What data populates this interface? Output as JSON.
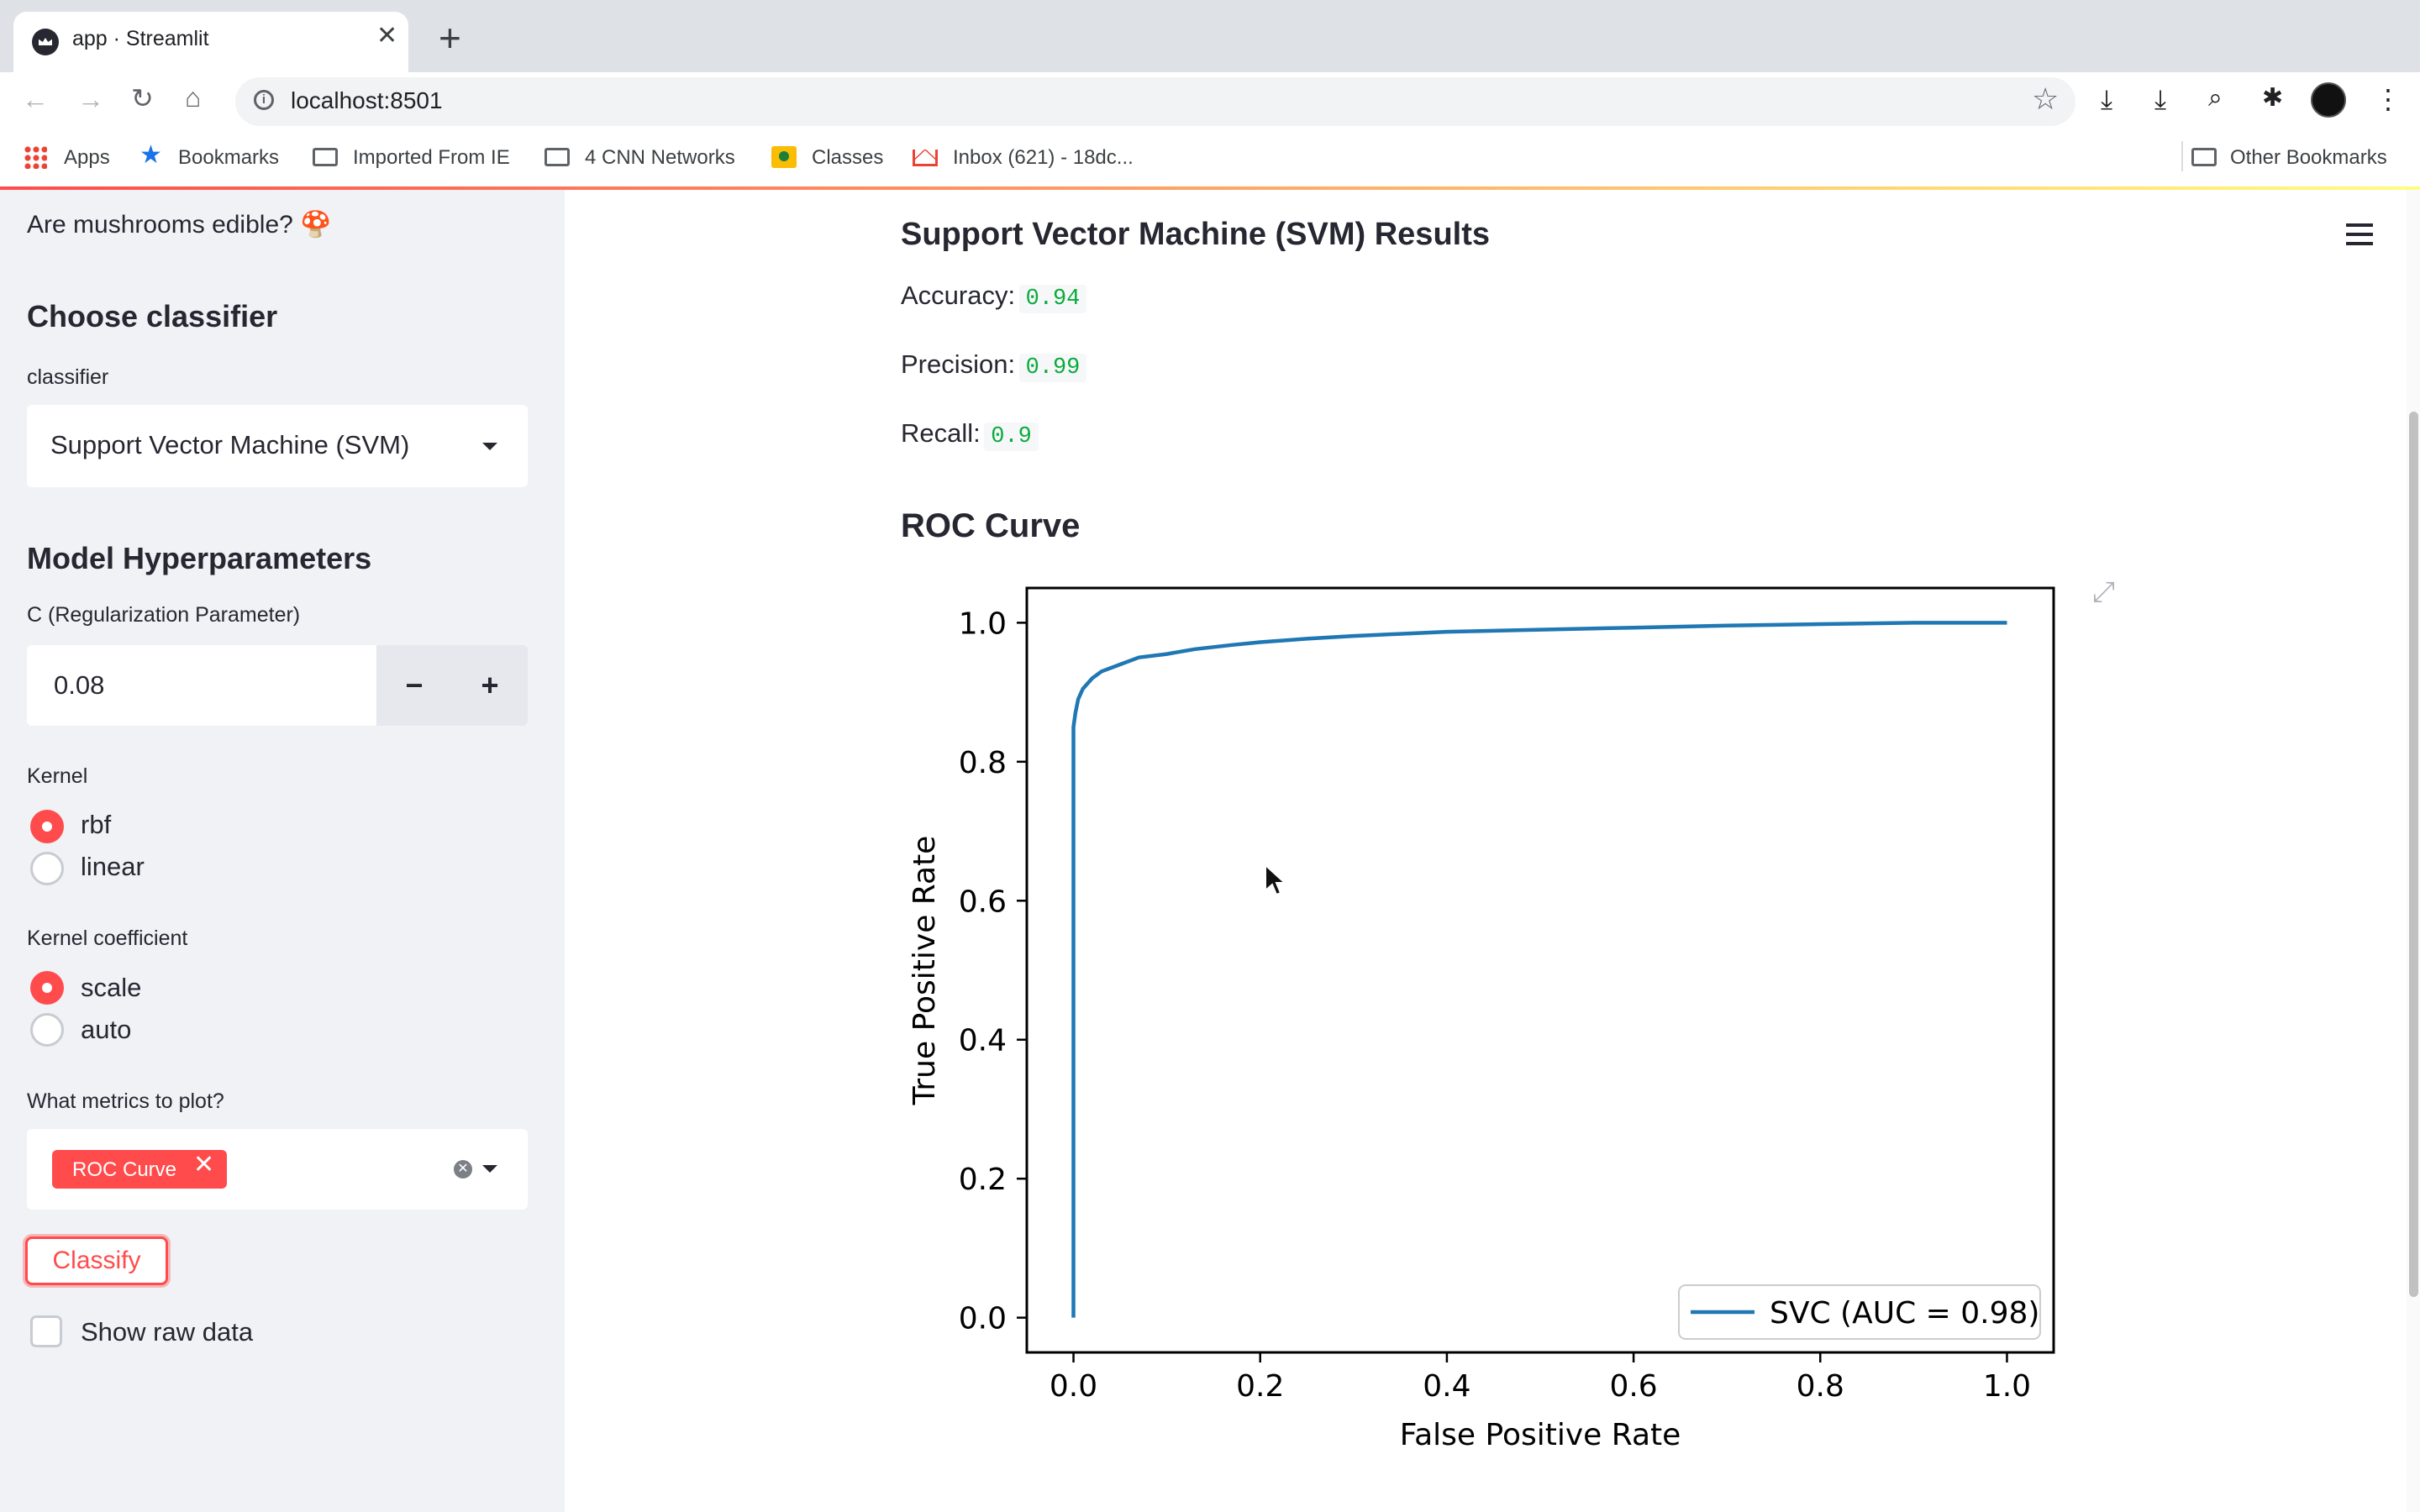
{
  "browser": {
    "tab_title": "app · Streamlit",
    "url": "localhost:8501",
    "bookmarks": {
      "apps": "Apps",
      "bookmarks": "Bookmarks",
      "imported": "Imported From IE",
      "cnn": "4 CNN Networks",
      "classes": "Classes",
      "inbox": "Inbox (621) - 18dc...",
      "other": "Other Bookmarks"
    }
  },
  "sidebar": {
    "title": "Are mushrooms edible? 🍄",
    "choose_heading": "Choose classifier",
    "classifier_label": "classifier",
    "classifier_value": "Support Vector Machine (SVM)",
    "hyper_heading": "Model Hyperparameters",
    "c_label": "C (Regularization Parameter)",
    "c_value": "0.08",
    "minus": "−",
    "plus": "+",
    "kernel_label": "Kernel",
    "kernel_options": [
      "rbf",
      "linear"
    ],
    "kernel_selected": "rbf",
    "gamma_label": "Kernel coefficient",
    "gamma_options": [
      "scale",
      "auto"
    ],
    "gamma_selected": "scale",
    "metrics_label": "What metrics to plot?",
    "metrics_selected": [
      "ROC Curve"
    ],
    "classify_label": "Classify",
    "raw_data_label": "Show raw data",
    "raw_data_checked": false
  },
  "main": {
    "results_title": "Support Vector Machine (SVM) Results",
    "accuracy_label": "Accuracy:",
    "accuracy_value": "0.94",
    "precision_label": "Precision:",
    "precision_value": "0.99",
    "recall_label": "Recall:",
    "recall_value": "0.9",
    "roc_title": "ROC Curve"
  },
  "colors": {
    "accent": "#ff4b4b",
    "metric_value": "#09ab3b",
    "line": "#1f77b4"
  },
  "chart_data": {
    "type": "line",
    "title": "",
    "xlabel": "False Positive Rate",
    "ylabel": "True Positive Rate",
    "xlim": [
      -0.05,
      1.05
    ],
    "ylim": [
      -0.05,
      1.05
    ],
    "xticks": [
      "0.0",
      "0.2",
      "0.4",
      "0.6",
      "0.8",
      "1.0"
    ],
    "yticks": [
      "0.0",
      "0.2",
      "0.4",
      "0.6",
      "0.8",
      "1.0"
    ],
    "grid": false,
    "legend_position": "lower-right",
    "series": [
      {
        "name": "SVC (AUC = 0.98)",
        "x": [
          0.0,
          0.0,
          0.0,
          0.002,
          0.005,
          0.01,
          0.02,
          0.03,
          0.05,
          0.07,
          0.1,
          0.13,
          0.17,
          0.2,
          0.25,
          0.3,
          0.35,
          0.4,
          0.5,
          0.6,
          0.7,
          0.8,
          0.9,
          1.0
        ],
        "y": [
          0.0,
          0.8,
          0.85,
          0.87,
          0.89,
          0.905,
          0.92,
          0.93,
          0.94,
          0.95,
          0.955,
          0.962,
          0.968,
          0.972,
          0.977,
          0.981,
          0.984,
          0.987,
          0.99,
          0.993,
          0.996,
          0.998,
          1.0,
          1.0
        ]
      }
    ]
  }
}
